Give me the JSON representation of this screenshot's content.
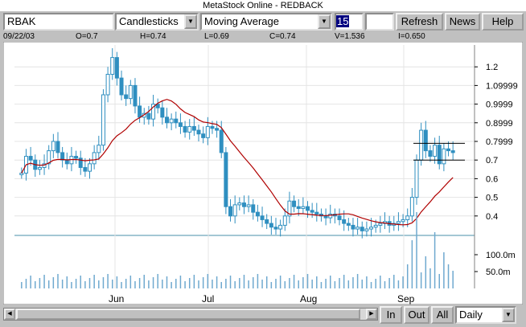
{
  "window": {
    "title": "MetaStock Online - REDBACK"
  },
  "toolbar": {
    "symbol": "RBAK",
    "chart_type": "Candlesticks",
    "indicator": "Moving Average",
    "period_value": "15",
    "refresh_label": "Refresh",
    "news_label": "News",
    "help_label": "Help"
  },
  "quote": {
    "date": "09/22/03",
    "open": "O=0.7",
    "high": "H=0.74",
    "low": "L=0.69",
    "close": "C=0.74",
    "volume": "V=1.536",
    "interest": "I=0.650"
  },
  "bottom": {
    "zoom_in": "In",
    "zoom_out": "Out",
    "zoom_all": "All",
    "periodicity": "Daily"
  },
  "chart_data": {
    "type": "candlestick",
    "x_tick_labels": [
      "Jun",
      "Jul",
      "Aug",
      "Sep"
    ],
    "y_tick_labels": [
      "1.2",
      "1.09999",
      "0.9999",
      "0.8999",
      "0.7999",
      "0.7",
      "0.6",
      "0.5",
      "0.4"
    ],
    "volume_tick_labels": [
      "100.0m",
      "50.0m"
    ],
    "ylim": [
      0.3,
      1.3
    ],
    "volume_ylim": [
      0,
      150
    ],
    "indicator": {
      "name": "Moving Average",
      "period": 15
    },
    "price_closes_approx": [
      0.63,
      0.72,
      0.7,
      0.65,
      0.66,
      0.68,
      0.75,
      0.8,
      0.74,
      0.7,
      0.68,
      0.72,
      0.71,
      0.66,
      0.64,
      0.68,
      0.74,
      0.78,
      1.05,
      1.16,
      1.25,
      1.14,
      1.05,
      1.03,
      1.1,
      0.99,
      0.93,
      0.95,
      0.92,
      1.0,
      0.98,
      0.93,
      0.9,
      0.92,
      0.9,
      0.88,
      0.85,
      0.88,
      0.86,
      0.84,
      0.82,
      0.88,
      0.87,
      0.86,
      0.74,
      0.45,
      0.4,
      0.46,
      0.47,
      0.45,
      0.46,
      0.42,
      0.4,
      0.38,
      0.36,
      0.34,
      0.33,
      0.35,
      0.4,
      0.48,
      0.45,
      0.44,
      0.45,
      0.43,
      0.42,
      0.41,
      0.4,
      0.39,
      0.41,
      0.4,
      0.38,
      0.36,
      0.35,
      0.33,
      0.34,
      0.32,
      0.33,
      0.34,
      0.35,
      0.36,
      0.37,
      0.35,
      0.36,
      0.37,
      0.38,
      0.4,
      0.5,
      0.7,
      0.86,
      0.75,
      0.72,
      0.78,
      0.68,
      0.76,
      0.75,
      0.74
    ],
    "annotations": [
      {
        "type": "horizontal-line",
        "value": 0.79
      },
      {
        "type": "horizontal-line",
        "value": 0.7
      }
    ]
  }
}
